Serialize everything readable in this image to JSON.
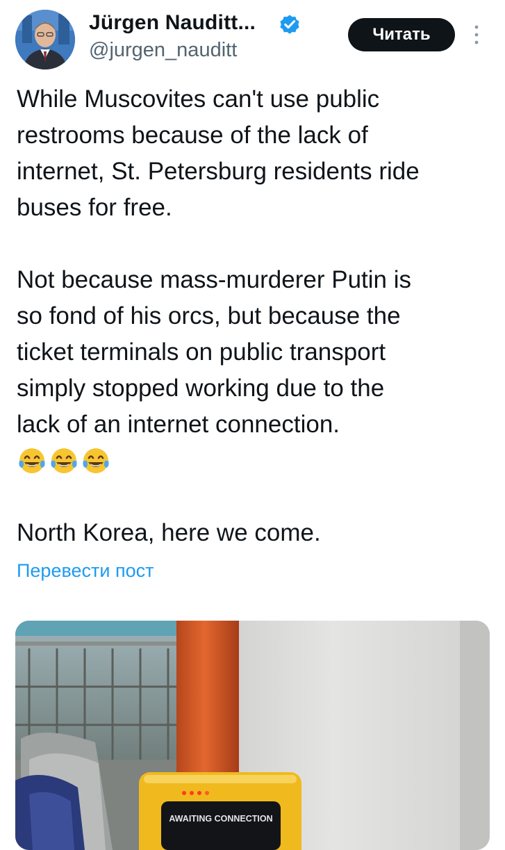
{
  "author": {
    "name": "Jürgen Nauditt...",
    "handle": "@jurgen_nauditt",
    "verified": true,
    "avatar_icon": "profile-photo-icon"
  },
  "header": {
    "read_button_label": "Читать",
    "more_icon": "more-vertical-icon"
  },
  "tweet": {
    "paragraph_1": "While Muscovites can't use public\nrestrooms because of the lack of\ninternet, St. Petersburg residents ride\nbuses for free.",
    "paragraph_2": "Not because mass-murderer Putin is\nso fond of his orcs, but because the\nticket terminals on public transport\nsimply stopped working due to the\nlack of an internet connection.",
    "emojis": [
      "😂",
      "😂",
      "😂"
    ],
    "paragraph_3": "North Korea, here we come.",
    "translate_label": "Перевести пост"
  },
  "media": {
    "terminal_screen_text": "AWAITING CONNECTION"
  },
  "colors": {
    "text": "#0f1419",
    "secondary_text": "#536471",
    "link": "#1d9bf0",
    "verified": "#1d9bf0",
    "button_bg": "#0f1419"
  }
}
